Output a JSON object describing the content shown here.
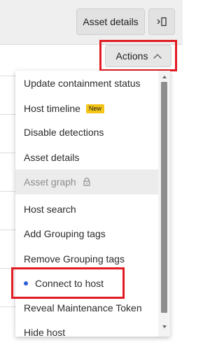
{
  "toolbar": {
    "asset_details_label": "Asset details",
    "panel_icon": "dock-right-icon"
  },
  "actions": {
    "label": "Actions",
    "icon": "chevron-up-icon"
  },
  "menu": {
    "items": [
      {
        "label": "Update containment status"
      },
      {
        "label": "Host timeline",
        "badge": "New"
      },
      {
        "label": "Disable detections"
      },
      {
        "label": "Asset details"
      },
      {
        "label": "Asset graph",
        "icon": "lock-icon"
      },
      {
        "label": "Host search"
      },
      {
        "label": "Add Grouping tags"
      },
      {
        "label": "Remove Grouping tags"
      },
      {
        "label": "Connect to host",
        "icon": "status-dot-icon"
      },
      {
        "label": "Reveal Maintenance Token"
      },
      {
        "label": "Hide host"
      }
    ]
  },
  "colors": {
    "highlight_outline": "#e21b23",
    "badge_background": "#f5c518",
    "status_dot": "#2b5fd9"
  }
}
